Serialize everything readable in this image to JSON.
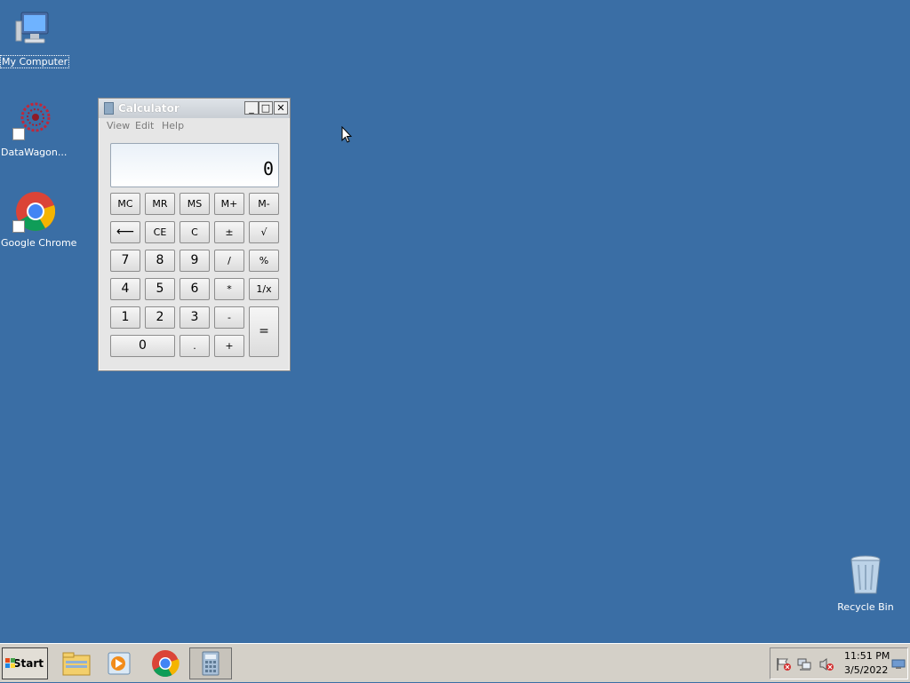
{
  "desktop": {
    "icons": [
      {
        "label": "My Computer",
        "icon": "computer-icon"
      },
      {
        "label": "DataWagon...",
        "icon": "datawagon-icon"
      },
      {
        "label": "Google Chrome",
        "icon": "chrome-icon"
      },
      {
        "label": "Recycle Bin",
        "icon": "recycle-bin-icon"
      }
    ]
  },
  "calculator": {
    "title": "Calculator",
    "menu": [
      "View",
      "Edit",
      "Help"
    ],
    "display": "0",
    "keys": {
      "mc": "MC",
      "mr": "MR",
      "ms": "MS",
      "mplus": "M+",
      "mminus": "M-",
      "back": "⟵",
      "ce": "CE",
      "c": "C",
      "plusminus": "±",
      "sqrt": "√",
      "k7": "7",
      "k8": "8",
      "k9": "9",
      "div": "/",
      "pct": "%",
      "k4": "4",
      "k5": "5",
      "k6": "6",
      "mul": "*",
      "recip": "1/x",
      "k1": "1",
      "k2": "2",
      "k3": "3",
      "sub": "-",
      "eq": "=",
      "k0": "0",
      "dot": ".",
      "add": "+"
    },
    "window_buttons": {
      "minimize": "_",
      "maximize": "□",
      "close": "✕"
    }
  },
  "taskbar": {
    "start_label": "Start",
    "apps": [
      "file-explorer-icon",
      "media-player-icon",
      "chrome-icon",
      "calculator-icon"
    ],
    "tray_icons": [
      "action-center-flag-icon",
      "network-icon",
      "volume-muted-icon"
    ],
    "time": "11:51 PM",
    "date": "3/5/2022"
  },
  "colors": {
    "desktop": "#3a6ea5",
    "taskbar": "#d4d0c8"
  }
}
